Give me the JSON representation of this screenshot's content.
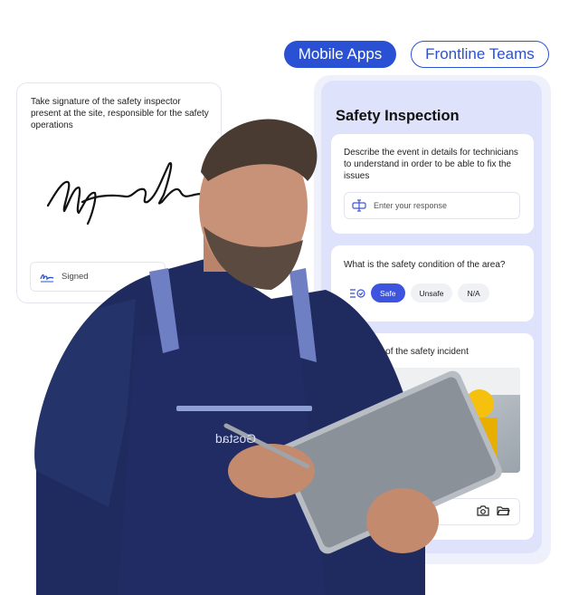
{
  "header": {
    "pill_primary": "Mobile Apps",
    "pill_secondary": "Frontline Teams"
  },
  "signature_card": {
    "prompt": "Take signature of the safety inspector present at the site, responsible for the safety operations",
    "signed_label": "Signed"
  },
  "app": {
    "title": "Safety Inspection",
    "q1": {
      "text": "Describe the event in details for technicians to understand in order to be able to fix the issues",
      "placeholder": "Enter your response"
    },
    "q2": {
      "text": "What is the safety condition of the area?",
      "options": [
        "Safe",
        "Unsafe",
        "N/A"
      ],
      "selected": "Safe"
    },
    "q3": {
      "text": "e pictures of the safety incident"
    }
  },
  "apron": {
    "brand": "Gostad"
  },
  "colors": {
    "brand_blue": "#2a50d4",
    "panel": "#dfe2fb",
    "shirt": "#1f2b5e"
  },
  "icons": [
    "signature-icon",
    "text-input-icon",
    "checklist-icon",
    "camera-icon",
    "folder-icon"
  ]
}
